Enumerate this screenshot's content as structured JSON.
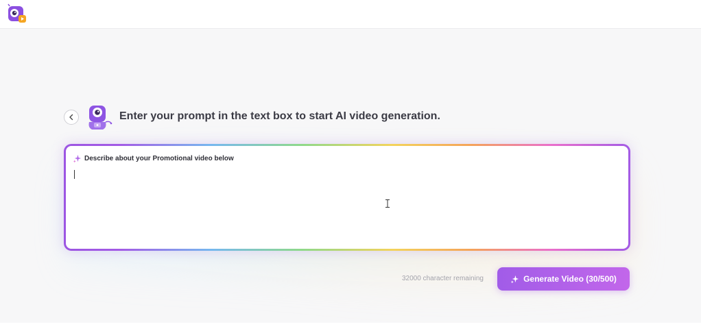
{
  "header": {
    "logo_icon": "app-logo-icon"
  },
  "page": {
    "back_icon": "chevron-left-icon",
    "mascot_icon": "robot-mascot-icon",
    "heading": "Enter your prompt in the text box to start AI video generation."
  },
  "prompt": {
    "label_icon": "sparkle-icon",
    "label": "Describe about your Promotional video below",
    "value": "",
    "placeholder": ""
  },
  "footer": {
    "remaining_text": "32000 character remaining",
    "generate_icon": "sparkle-icon",
    "generate_label": "Generate Video (30/500)"
  },
  "colors": {
    "accent": "#a35be5",
    "button_gradient_start": "#a15ce8",
    "button_gradient_end": "#c267ea",
    "heading_text": "#3b3b45",
    "muted_text": "#a3a3ab"
  }
}
